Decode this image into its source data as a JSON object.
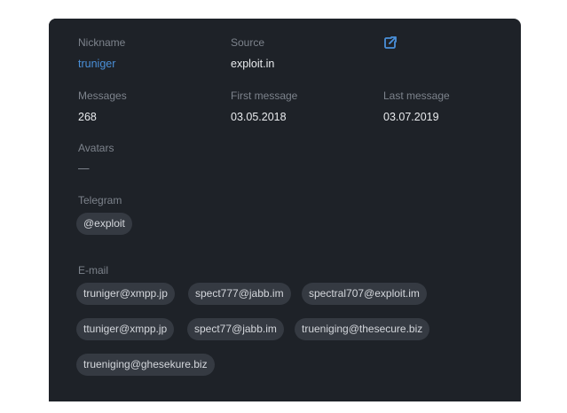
{
  "profile": {
    "nickname_label": "Nickname",
    "nickname_value": "truniger",
    "source_label": "Source",
    "source_value": "exploit.in",
    "external_link_icon": "external-link-icon",
    "messages_label": "Messages",
    "messages_value": "268",
    "first_message_label": "First message",
    "first_message_value": "03.05.2018",
    "last_message_label": "Last message",
    "last_message_value": "03.07.2019",
    "avatars_label": "Avatars",
    "avatars_value": "—",
    "telegram_label": "Telegram",
    "telegram_chips": [
      "@exploit"
    ],
    "email_label": "E-mail",
    "email_chips": [
      "truniger@xmpp.jp",
      "spect777@jabb.im",
      "spectral707@exploit.im",
      "ttuniger@xmpp.jp",
      "spect77@jabb.im",
      "trueniging@thesecure.biz",
      "trueniging@ghesekure.biz"
    ]
  },
  "colors": {
    "panel_bg": "#1e2228",
    "chip_bg": "#353a42",
    "label": "#7d838c",
    "value": "#e9ebee",
    "link": "#4a90d9"
  }
}
